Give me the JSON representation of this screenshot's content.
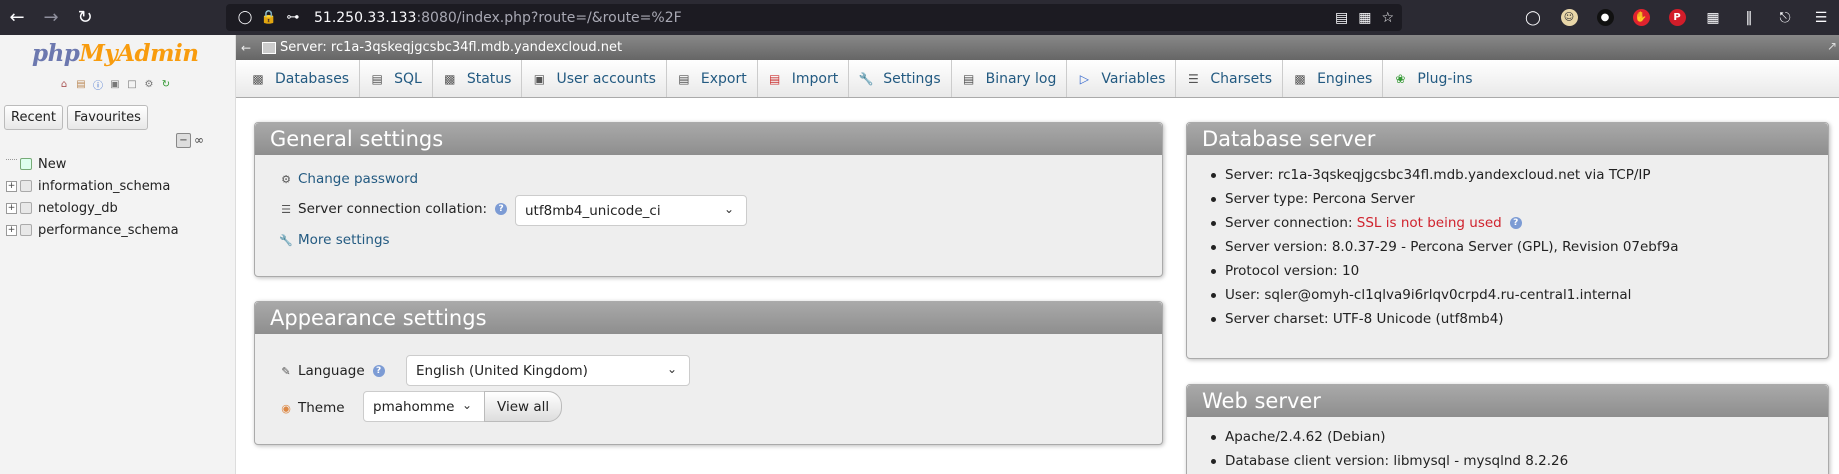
{
  "browser": {
    "url_host": "51.250.33.133",
    "url_rest": ":8080/index.php?route=/&route=%2F"
  },
  "sidebar": {
    "logo_php": "php",
    "logo_myadmin": "MyAdmin",
    "tabs": [
      "Recent",
      "Favourites"
    ],
    "tree": [
      {
        "label": "New"
      },
      {
        "label": "information_schema"
      },
      {
        "label": "netology_db"
      },
      {
        "label": "performance_schema"
      }
    ]
  },
  "serverbar": {
    "label": "Server: rc1a-3qskeqjgcsbc34fl.mdb.yandexcloud.net"
  },
  "menu": {
    "tabs": [
      {
        "label": "Databases",
        "icon": "database-icon"
      },
      {
        "label": "SQL",
        "icon": "sql-icon"
      },
      {
        "label": "Status",
        "icon": "status-icon"
      },
      {
        "label": "User accounts",
        "icon": "users-icon"
      },
      {
        "label": "Export",
        "icon": "export-icon"
      },
      {
        "label": "Import",
        "icon": "import-icon"
      },
      {
        "label": "Settings",
        "icon": "wrench-icon"
      },
      {
        "label": "Binary log",
        "icon": "binary-log-icon"
      },
      {
        "label": "Variables",
        "icon": "variables-icon"
      },
      {
        "label": "Charsets",
        "icon": "charsets-icon"
      },
      {
        "label": "Engines",
        "icon": "engines-icon"
      },
      {
        "label": "Plug-ins",
        "icon": "plugin-icon"
      }
    ]
  },
  "general": {
    "title": "General settings",
    "change_password": "Change password",
    "collation_label": "Server connection collation:",
    "collation_value": "utf8mb4_unicode_ci",
    "more_settings": "More settings"
  },
  "appearance": {
    "title": "Appearance settings",
    "language_label": "Language",
    "language_value": "English (United Kingdom)",
    "theme_label": "Theme",
    "theme_value": "pmahomme",
    "view_all": "View all"
  },
  "dbserver": {
    "title": "Database server",
    "items": {
      "server": "Server: rc1a-3qskeqjgcsbc34fl.mdb.yandexcloud.net via TCP/IP",
      "type": "Server type: Percona Server",
      "connection_label": "Server connection:",
      "connection_value": "SSL is not being used",
      "version": "Server version: 8.0.37-29 - Percona Server (GPL), Revision 07ebf9a",
      "protocol": "Protocol version: 10",
      "user": "User: sqler@omyh-cl1qlva9i6rlqv0crpd4.ru-central1.internal",
      "charset": "Server charset: UTF-8 Unicode (utf8mb4)"
    }
  },
  "webserver": {
    "title": "Web server",
    "items": {
      "apache": "Apache/2.4.62 (Debian)",
      "client": "Database client version: libmysql - mysqlnd 8.2.26"
    }
  }
}
